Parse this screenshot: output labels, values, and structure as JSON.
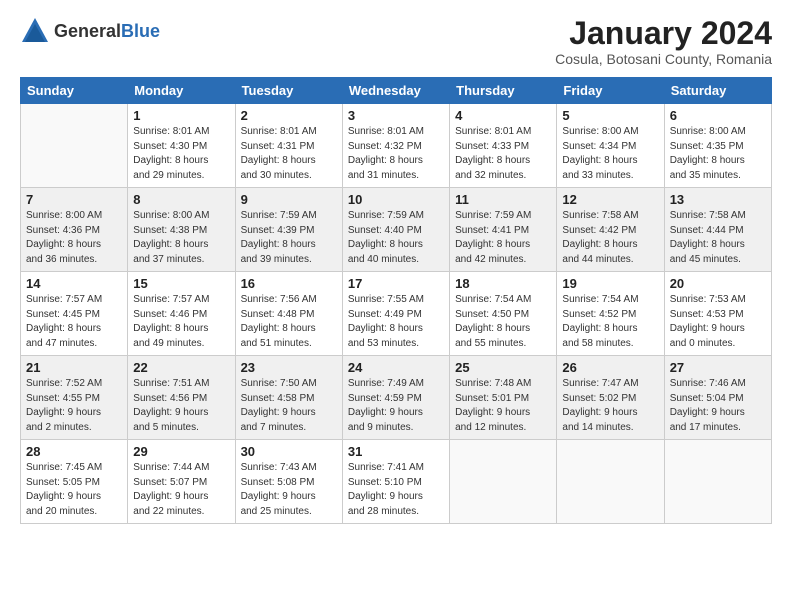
{
  "header": {
    "logo_general": "General",
    "logo_blue": "Blue",
    "month_title": "January 2024",
    "location": "Cosula, Botosani County, Romania"
  },
  "weekdays": [
    "Sunday",
    "Monday",
    "Tuesday",
    "Wednesday",
    "Thursday",
    "Friday",
    "Saturday"
  ],
  "weeks": [
    [
      {
        "day": "",
        "info": ""
      },
      {
        "day": "1",
        "info": "Sunrise: 8:01 AM\nSunset: 4:30 PM\nDaylight: 8 hours\nand 29 minutes."
      },
      {
        "day": "2",
        "info": "Sunrise: 8:01 AM\nSunset: 4:31 PM\nDaylight: 8 hours\nand 30 minutes."
      },
      {
        "day": "3",
        "info": "Sunrise: 8:01 AM\nSunset: 4:32 PM\nDaylight: 8 hours\nand 31 minutes."
      },
      {
        "day": "4",
        "info": "Sunrise: 8:01 AM\nSunset: 4:33 PM\nDaylight: 8 hours\nand 32 minutes."
      },
      {
        "day": "5",
        "info": "Sunrise: 8:00 AM\nSunset: 4:34 PM\nDaylight: 8 hours\nand 33 minutes."
      },
      {
        "day": "6",
        "info": "Sunrise: 8:00 AM\nSunset: 4:35 PM\nDaylight: 8 hours\nand 35 minutes."
      }
    ],
    [
      {
        "day": "7",
        "info": "Sunrise: 8:00 AM\nSunset: 4:36 PM\nDaylight: 8 hours\nand 36 minutes."
      },
      {
        "day": "8",
        "info": "Sunrise: 8:00 AM\nSunset: 4:38 PM\nDaylight: 8 hours\nand 37 minutes."
      },
      {
        "day": "9",
        "info": "Sunrise: 7:59 AM\nSunset: 4:39 PM\nDaylight: 8 hours\nand 39 minutes."
      },
      {
        "day": "10",
        "info": "Sunrise: 7:59 AM\nSunset: 4:40 PM\nDaylight: 8 hours\nand 40 minutes."
      },
      {
        "day": "11",
        "info": "Sunrise: 7:59 AM\nSunset: 4:41 PM\nDaylight: 8 hours\nand 42 minutes."
      },
      {
        "day": "12",
        "info": "Sunrise: 7:58 AM\nSunset: 4:42 PM\nDaylight: 8 hours\nand 44 minutes."
      },
      {
        "day": "13",
        "info": "Sunrise: 7:58 AM\nSunset: 4:44 PM\nDaylight: 8 hours\nand 45 minutes."
      }
    ],
    [
      {
        "day": "14",
        "info": "Sunrise: 7:57 AM\nSunset: 4:45 PM\nDaylight: 8 hours\nand 47 minutes."
      },
      {
        "day": "15",
        "info": "Sunrise: 7:57 AM\nSunset: 4:46 PM\nDaylight: 8 hours\nand 49 minutes."
      },
      {
        "day": "16",
        "info": "Sunrise: 7:56 AM\nSunset: 4:48 PM\nDaylight: 8 hours\nand 51 minutes."
      },
      {
        "day": "17",
        "info": "Sunrise: 7:55 AM\nSunset: 4:49 PM\nDaylight: 8 hours\nand 53 minutes."
      },
      {
        "day": "18",
        "info": "Sunrise: 7:54 AM\nSunset: 4:50 PM\nDaylight: 8 hours\nand 55 minutes."
      },
      {
        "day": "19",
        "info": "Sunrise: 7:54 AM\nSunset: 4:52 PM\nDaylight: 8 hours\nand 58 minutes."
      },
      {
        "day": "20",
        "info": "Sunrise: 7:53 AM\nSunset: 4:53 PM\nDaylight: 9 hours\nand 0 minutes."
      }
    ],
    [
      {
        "day": "21",
        "info": "Sunrise: 7:52 AM\nSunset: 4:55 PM\nDaylight: 9 hours\nand 2 minutes."
      },
      {
        "day": "22",
        "info": "Sunrise: 7:51 AM\nSunset: 4:56 PM\nDaylight: 9 hours\nand 5 minutes."
      },
      {
        "day": "23",
        "info": "Sunrise: 7:50 AM\nSunset: 4:58 PM\nDaylight: 9 hours\nand 7 minutes."
      },
      {
        "day": "24",
        "info": "Sunrise: 7:49 AM\nSunset: 4:59 PM\nDaylight: 9 hours\nand 9 minutes."
      },
      {
        "day": "25",
        "info": "Sunrise: 7:48 AM\nSunset: 5:01 PM\nDaylight: 9 hours\nand 12 minutes."
      },
      {
        "day": "26",
        "info": "Sunrise: 7:47 AM\nSunset: 5:02 PM\nDaylight: 9 hours\nand 14 minutes."
      },
      {
        "day": "27",
        "info": "Sunrise: 7:46 AM\nSunset: 5:04 PM\nDaylight: 9 hours\nand 17 minutes."
      }
    ],
    [
      {
        "day": "28",
        "info": "Sunrise: 7:45 AM\nSunset: 5:05 PM\nDaylight: 9 hours\nand 20 minutes."
      },
      {
        "day": "29",
        "info": "Sunrise: 7:44 AM\nSunset: 5:07 PM\nDaylight: 9 hours\nand 22 minutes."
      },
      {
        "day": "30",
        "info": "Sunrise: 7:43 AM\nSunset: 5:08 PM\nDaylight: 9 hours\nand 25 minutes."
      },
      {
        "day": "31",
        "info": "Sunrise: 7:41 AM\nSunset: 5:10 PM\nDaylight: 9 hours\nand 28 minutes."
      },
      {
        "day": "",
        "info": ""
      },
      {
        "day": "",
        "info": ""
      },
      {
        "day": "",
        "info": ""
      }
    ]
  ],
  "shaded_rows": [
    1,
    3
  ]
}
